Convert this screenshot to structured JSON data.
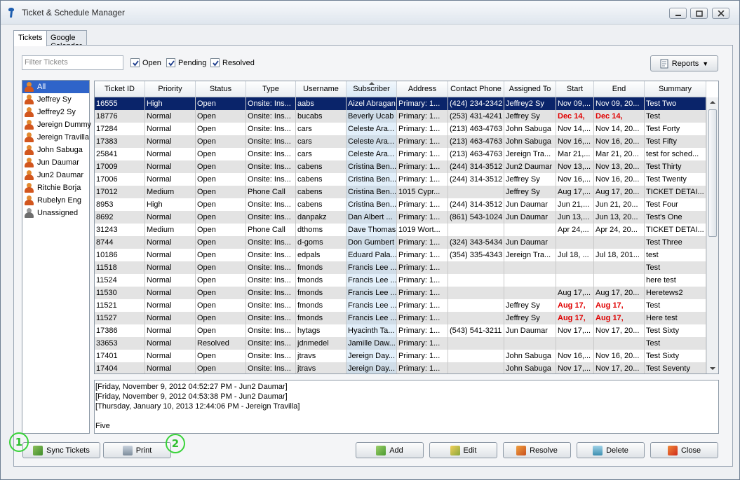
{
  "window": {
    "title": "Ticket & Schedule Manager"
  },
  "tabs": [
    {
      "label": "Tickets"
    },
    {
      "label": "Google Calendar"
    }
  ],
  "filter": {
    "placeholder": "Filter Tickets"
  },
  "status_filters": [
    {
      "label": "Open",
      "checked": true
    },
    {
      "label": "Pending",
      "checked": true
    },
    {
      "label": "Resolved",
      "checked": true
    }
  ],
  "reports_button": {
    "label": "Reports",
    "dropdown_glyph": "▼"
  },
  "users": [
    {
      "label": "All",
      "selected": true,
      "icon": "user-icon"
    },
    {
      "label": "Jeffrey Sy",
      "icon": "user-icon"
    },
    {
      "label": "Jeffrey2 Sy",
      "icon": "user-icon"
    },
    {
      "label": "Jereign Dummy",
      "icon": "user-icon"
    },
    {
      "label": "Jereign Travilla",
      "icon": "user-icon"
    },
    {
      "label": "John Sabuga",
      "icon": "user-icon"
    },
    {
      "label": "Jun Daumar",
      "icon": "user-icon"
    },
    {
      "label": "Jun2 Daumar",
      "icon": "user-icon"
    },
    {
      "label": "Ritchie Borja",
      "icon": "user-icon"
    },
    {
      "label": "Rubelyn Eng",
      "icon": "user-icon"
    },
    {
      "label": "Unassigned",
      "icon": "user-gray-icon"
    }
  ],
  "table": {
    "columns": [
      "Ticket ID",
      "Priority",
      "Status",
      "Type",
      "Username",
      "Subscriber",
      "Address",
      "Contact Phone",
      "Assigned To",
      "Start",
      "End",
      "Summary"
    ],
    "sorted_column": "Subscriber",
    "rows": [
      [
        "16555",
        "High",
        "Open",
        "Onsite: Ins...",
        "aabs",
        "Aizel Abragan",
        "Primary: 1...",
        "(424) 234-2342",
        "Jeffrey2 Sy",
        "Nov 09,...",
        "Nov 09, 20...",
        "Test Two"
      ],
      [
        "18776",
        "Normal",
        "Open",
        "Onsite: Ins...",
        "bucabs",
        "Beverly Ucab",
        "Primary: 1...",
        "(253) 431-4241",
        "Jeffrey Sy",
        "Dec 14,",
        "Dec 14,",
        "Test"
      ],
      [
        "17284",
        "Normal",
        "Open",
        "Onsite: Ins...",
        "cars",
        "Celeste Ara...",
        "Primary: 1...",
        "(213) 463-4763",
        "John Sabuga",
        "Nov 14,...",
        "Nov 14, 20...",
        "Test Forty"
      ],
      [
        "17383",
        "Normal",
        "Open",
        "Onsite: Ins...",
        "cars",
        "Celeste Ara...",
        "Primary: 1...",
        "(213) 463-4763",
        "John Sabuga",
        "Nov 16,...",
        "Nov 16, 20...",
        "Test Fifty"
      ],
      [
        "25841",
        "Normal",
        "Open",
        "Onsite: Ins...",
        "cars",
        "Celeste Ara...",
        "Primary: 1...",
        "(213) 463-4763",
        "Jereign Tra...",
        "Mar 21,...",
        "Mar 21, 20...",
        "test for sched..."
      ],
      [
        "17009",
        "Normal",
        "Open",
        "Onsite: Ins...",
        "cabens",
        "Cristina Ben...",
        "Primary: 1...",
        "(244) 314-3512",
        "Jun2 Daumar",
        "Nov 13,...",
        "Nov 13, 20...",
        "Test Thirty"
      ],
      [
        "17006",
        "Normal",
        "Open",
        "Onsite: Ins...",
        "cabens",
        "Cristina Ben...",
        "Primary: 1...",
        "(244) 314-3512",
        "Jeffrey Sy",
        "Nov 16,...",
        "Nov 16, 20...",
        "Test Twenty"
      ],
      [
        "17012",
        "Medium",
        "Open",
        "Phone Call",
        "cabens",
        "Cristina Ben...",
        "1015 Cypr...",
        "",
        "Jeffrey Sy",
        "Aug 17,...",
        "Aug 17, 20...",
        "TICKET DETAI..."
      ],
      [
        "8953",
        "High",
        "Open",
        "Onsite: Ins...",
        "cabens",
        "Cristina Ben...",
        "Primary: 1...",
        "(244) 314-3512",
        "Jun Daumar",
        "Jun 21,...",
        "Jun 21, 20...",
        "Test Four"
      ],
      [
        "8692",
        "Normal",
        "Open",
        "Onsite: Ins...",
        "danpakz",
        "Dan Albert ...",
        "Primary: 1...",
        "(861) 543-1024",
        "Jun Daumar",
        "Jun 13,...",
        "Jun 13, 20...",
        "Test's One"
      ],
      [
        "31243",
        "Medium",
        "Open",
        "Phone Call",
        "dthoms",
        "Dave Thomas",
        "1019 Wort...",
        "",
        "",
        "Apr 24,...",
        "Apr 24, 20...",
        "TICKET DETAI..."
      ],
      [
        "8744",
        "Normal",
        "Open",
        "Onsite: Ins...",
        "d-goms",
        "Don Gumbert",
        "Primary: 1...",
        "(324) 343-5434",
        "Jun Daumar",
        "",
        "",
        "Test Three"
      ],
      [
        "10186",
        "Normal",
        "Open",
        "Onsite: Ins...",
        "edpals",
        "Eduard Pala...",
        "Primary: 1...",
        "(354) 335-4343",
        "Jereign Tra...",
        "Jul 18, ...",
        "Jul 18, 201...",
        "test"
      ],
      [
        "11518",
        "Normal",
        "Open",
        "Onsite: Ins...",
        "fmonds",
        "Francis Lee ...",
        "Primary: 1...",
        "",
        "",
        "",
        "",
        "Test"
      ],
      [
        "11524",
        "Normal",
        "Open",
        "Onsite: Ins...",
        "fmonds",
        "Francis Lee ...",
        "Primary: 1...",
        "",
        "",
        "",
        "",
        "here test"
      ],
      [
        "11530",
        "Normal",
        "Open",
        "Onsite: Ins...",
        "fmonds",
        "Francis Lee ...",
        "Primary: 1...",
        "",
        "",
        "Aug 17,...",
        "Aug 17, 20...",
        "Heretews2"
      ],
      [
        "11521",
        "Normal",
        "Open",
        "Onsite: Ins...",
        "fmonds",
        "Francis Lee ...",
        "Primary: 1...",
        "",
        "Jeffrey Sy",
        "Aug 17,",
        "Aug 17,",
        "Test"
      ],
      [
        "11527",
        "Normal",
        "Open",
        "Onsite: Ins...",
        "fmonds",
        "Francis Lee ...",
        "Primary: 1...",
        "",
        "Jeffrey Sy",
        "Aug 17,",
        "Aug 17,",
        "Here test"
      ],
      [
        "17386",
        "Normal",
        "Open",
        "Onsite: Ins...",
        "hytags",
        "Hyacinth Ta...",
        "Primary: 1...",
        "(543) 541-3211",
        "Jun Daumar",
        "Nov 17,...",
        "Nov 17, 20...",
        "Test Sixty"
      ],
      [
        "33653",
        "Normal",
        "Resolved",
        "Onsite: Ins...",
        "jdnmedel",
        "Jamille Daw...",
        "Primary: 1...",
        "",
        "",
        "",
        "",
        "Test"
      ],
      [
        "17401",
        "Normal",
        "Open",
        "Onsite: Ins...",
        "jtravs",
        "Jereign Day...",
        "Primary: 1...",
        "",
        "John Sabuga",
        "Nov 16,...",
        "Nov 16, 20...",
        "Test Sixty"
      ],
      [
        "17404",
        "Normal",
        "Open",
        "Onsite: Ins...",
        "jtravs",
        "Jereign Day...",
        "Primary: 1...",
        "",
        "John Sabuga",
        "Nov 17,...",
        "Nov 17, 20...",
        "Test Seventy"
      ]
    ],
    "selected_row": 0,
    "overdue_rows": [
      1,
      16,
      17
    ],
    "overdue_color": "#e00000"
  },
  "log": {
    "lines": [
      "[Friday, November 9, 2012 04:52:27 PM - Jun2 Daumar]",
      "[Friday, November 9, 2012 04:53:38 PM - Jun2 Daumar]",
      "[Thursday, January 10, 2013 12:44:06 PM - Jereign Travilla]",
      "",
      "Five"
    ]
  },
  "buttons": {
    "sync": {
      "label": "Sync Tickets",
      "icon": "sync-icon"
    },
    "print": {
      "label": "Print",
      "icon": "printer-icon"
    },
    "add": {
      "label": "Add",
      "icon": "add-icon"
    },
    "edit": {
      "label": "Edit",
      "icon": "edit-icon"
    },
    "resolve": {
      "label": "Resolve",
      "icon": "resolve-icon"
    },
    "delete": {
      "label": "Delete",
      "icon": "trash-icon"
    },
    "close": {
      "label": "Close",
      "icon": "close-icon"
    }
  },
  "callouts": [
    "1",
    "2"
  ],
  "colors": {
    "selection": "#0a246a",
    "list_selection": "#2f64c9",
    "callout": "#39d339"
  }
}
